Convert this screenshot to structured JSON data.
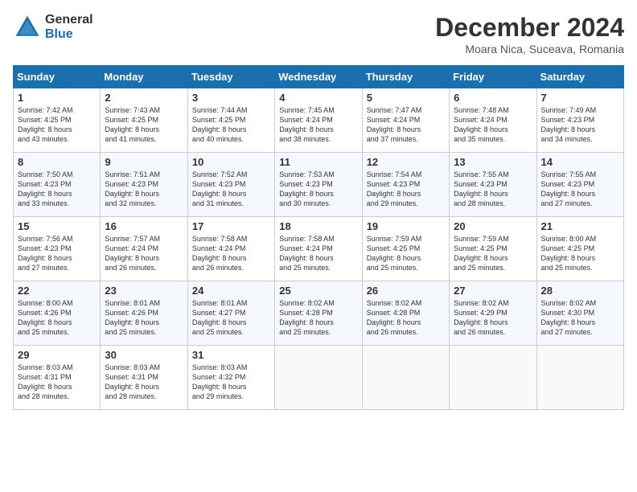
{
  "header": {
    "logo_general": "General",
    "logo_blue": "Blue",
    "month_title": "December 2024",
    "location": "Moara Nica, Suceava, Romania"
  },
  "calendar": {
    "days_of_week": [
      "Sunday",
      "Monday",
      "Tuesday",
      "Wednesday",
      "Thursday",
      "Friday",
      "Saturday"
    ],
    "weeks": [
      [
        {
          "day": "",
          "content": ""
        },
        {
          "day": "2",
          "content": "Sunrise: 7:43 AM\nSunset: 4:25 PM\nDaylight: 8 hours\nand 41 minutes."
        },
        {
          "day": "3",
          "content": "Sunrise: 7:44 AM\nSunset: 4:25 PM\nDaylight: 8 hours\nand 40 minutes."
        },
        {
          "day": "4",
          "content": "Sunrise: 7:45 AM\nSunset: 4:24 PM\nDaylight: 8 hours\nand 38 minutes."
        },
        {
          "day": "5",
          "content": "Sunrise: 7:47 AM\nSunset: 4:24 PM\nDaylight: 8 hours\nand 37 minutes."
        },
        {
          "day": "6",
          "content": "Sunrise: 7:48 AM\nSunset: 4:24 PM\nDaylight: 8 hours\nand 35 minutes."
        },
        {
          "day": "7",
          "content": "Sunrise: 7:49 AM\nSunset: 4:23 PM\nDaylight: 8 hours\nand 34 minutes."
        }
      ],
      [
        {
          "day": "1",
          "content": "Sunrise: 7:42 AM\nSunset: 4:25 PM\nDaylight: 8 hours\nand 43 minutes."
        },
        {
          "day": "9",
          "content": "Sunrise: 7:51 AM\nSunset: 4:23 PM\nDaylight: 8 hours\nand 32 minutes."
        },
        {
          "day": "10",
          "content": "Sunrise: 7:52 AM\nSunset: 4:23 PM\nDaylight: 8 hours\nand 31 minutes."
        },
        {
          "day": "11",
          "content": "Sunrise: 7:53 AM\nSunset: 4:23 PM\nDaylight: 8 hours\nand 30 minutes."
        },
        {
          "day": "12",
          "content": "Sunrise: 7:54 AM\nSunset: 4:23 PM\nDaylight: 8 hours\nand 29 minutes."
        },
        {
          "day": "13",
          "content": "Sunrise: 7:55 AM\nSunset: 4:23 PM\nDaylight: 8 hours\nand 28 minutes."
        },
        {
          "day": "14",
          "content": "Sunrise: 7:55 AM\nSunset: 4:23 PM\nDaylight: 8 hours\nand 27 minutes."
        }
      ],
      [
        {
          "day": "8",
          "content": "Sunrise: 7:50 AM\nSunset: 4:23 PM\nDaylight: 8 hours\nand 33 minutes."
        },
        {
          "day": "16",
          "content": "Sunrise: 7:57 AM\nSunset: 4:24 PM\nDaylight: 8 hours\nand 26 minutes."
        },
        {
          "day": "17",
          "content": "Sunrise: 7:58 AM\nSunset: 4:24 PM\nDaylight: 8 hours\nand 26 minutes."
        },
        {
          "day": "18",
          "content": "Sunrise: 7:58 AM\nSunset: 4:24 PM\nDaylight: 8 hours\nand 25 minutes."
        },
        {
          "day": "19",
          "content": "Sunrise: 7:59 AM\nSunset: 4:25 PM\nDaylight: 8 hours\nand 25 minutes."
        },
        {
          "day": "20",
          "content": "Sunrise: 7:59 AM\nSunset: 4:25 PM\nDaylight: 8 hours\nand 25 minutes."
        },
        {
          "day": "21",
          "content": "Sunrise: 8:00 AM\nSunset: 4:25 PM\nDaylight: 8 hours\nand 25 minutes."
        }
      ],
      [
        {
          "day": "15",
          "content": "Sunrise: 7:56 AM\nSunset: 4:23 PM\nDaylight: 8 hours\nand 27 minutes."
        },
        {
          "day": "23",
          "content": "Sunrise: 8:01 AM\nSunset: 4:26 PM\nDaylight: 8 hours\nand 25 minutes."
        },
        {
          "day": "24",
          "content": "Sunrise: 8:01 AM\nSunset: 4:27 PM\nDaylight: 8 hours\nand 25 minutes."
        },
        {
          "day": "25",
          "content": "Sunrise: 8:02 AM\nSunset: 4:28 PM\nDaylight: 8 hours\nand 25 minutes."
        },
        {
          "day": "26",
          "content": "Sunrise: 8:02 AM\nSunset: 4:28 PM\nDaylight: 8 hours\nand 26 minutes."
        },
        {
          "day": "27",
          "content": "Sunrise: 8:02 AM\nSunset: 4:29 PM\nDaylight: 8 hours\nand 26 minutes."
        },
        {
          "day": "28",
          "content": "Sunrise: 8:02 AM\nSunset: 4:30 PM\nDaylight: 8 hours\nand 27 minutes."
        }
      ],
      [
        {
          "day": "22",
          "content": "Sunrise: 8:00 AM\nSunset: 4:26 PM\nDaylight: 8 hours\nand 25 minutes."
        },
        {
          "day": "30",
          "content": "Sunrise: 8:03 AM\nSunset: 4:31 PM\nDaylight: 8 hours\nand 28 minutes."
        },
        {
          "day": "31",
          "content": "Sunrise: 8:03 AM\nSunset: 4:32 PM\nDaylight: 8 hours\nand 29 minutes."
        },
        {
          "day": "",
          "content": ""
        },
        {
          "day": "",
          "content": ""
        },
        {
          "day": "",
          "content": ""
        },
        {
          "day": "",
          "content": ""
        }
      ],
      [
        {
          "day": "29",
          "content": "Sunrise: 8:03 AM\nSunset: 4:31 PM\nDaylight: 8 hours\nand 28 minutes."
        },
        {
          "day": "",
          "content": ""
        },
        {
          "day": "",
          "content": ""
        },
        {
          "day": "",
          "content": ""
        },
        {
          "day": "",
          "content": ""
        },
        {
          "day": "",
          "content": ""
        },
        {
          "day": "",
          "content": ""
        }
      ]
    ]
  }
}
